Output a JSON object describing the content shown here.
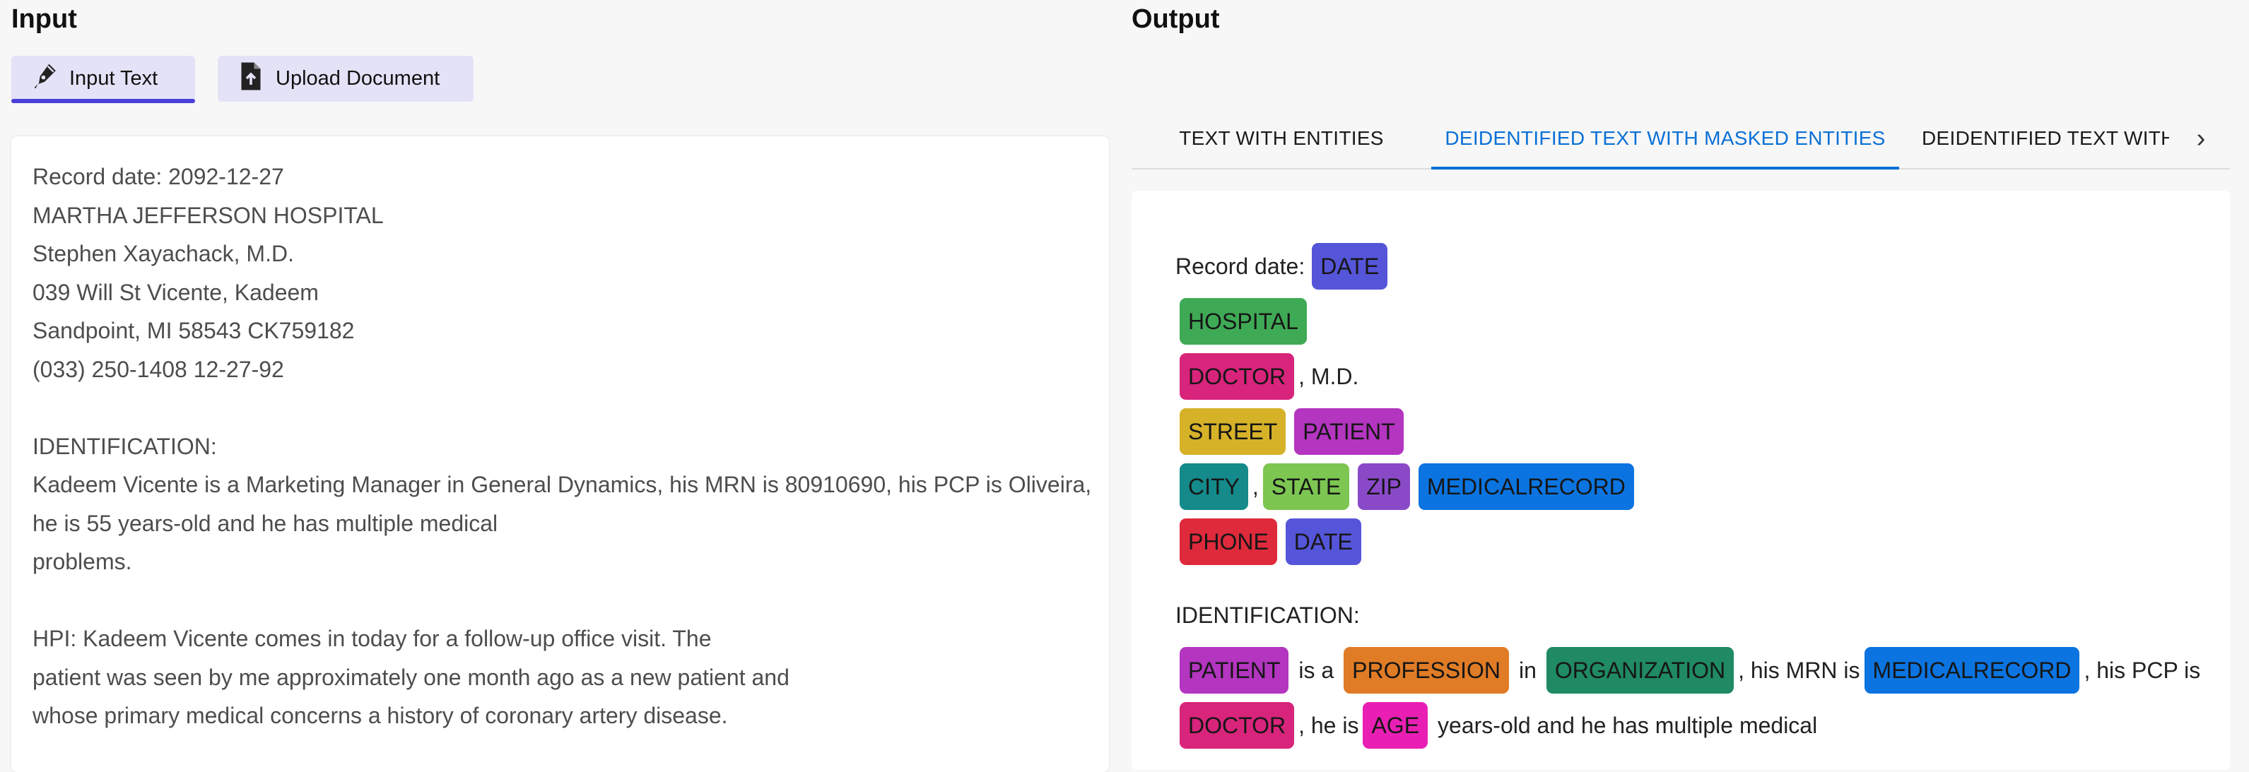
{
  "input_panel": {
    "title": "Input",
    "buttons": [
      {
        "label": "Input Text",
        "icon": "pen-icon",
        "active": true
      },
      {
        "label": "Upload Document",
        "icon": "file-upload-icon",
        "active": false
      }
    ],
    "text_lines": [
      "Record date: 2092-12-27",
      "MARTHA JEFFERSON HOSPITAL",
      "Stephen Xayachack, M.D.",
      "039 Will St Vicente, Kadeem",
      "Sandpoint, MI 58543 CK759182",
      "(033) 250-1408 12-27-92",
      "",
      "IDENTIFICATION:",
      "Kadeem Vicente is a Marketing Manager in General Dynamics, his MRN is 80910690, his PCP is Oliveira,",
      "he is 55 years-old and he has multiple medical",
      "problems.",
      "",
      "HPI: Kadeem Vicente comes in today for a follow-up office visit. The",
      "patient was seen by me approximately one month ago as a new patient and",
      "whose primary medical concerns a history of coronary artery disease."
    ]
  },
  "output_panel": {
    "title": "Output",
    "tabs": [
      {
        "label": "TEXT WITH ENTITIES",
        "active": false
      },
      {
        "label": "DEIDENTIFIED TEXT WITH MASKED ENTITIES",
        "active": true
      },
      {
        "label": "DEIDENTIFIED TEXT WITH",
        "active": false
      }
    ],
    "tab_scroll_icon": "chevron-right-icon",
    "chevron_glyph": "›",
    "rows": {
      "r1": {
        "t1": "Record date:",
        "c1": "DATE"
      },
      "r2": {
        "c1": "HOSPITAL"
      },
      "r3": {
        "c1": "DOCTOR",
        "t1": ", M.D."
      },
      "r4": {
        "c1": "STREET",
        "c2": "PATIENT"
      },
      "r5": {
        "c1": "CITY",
        "t1": ",",
        "c2": "STATE",
        "c3": "ZIP",
        "c4": "MEDICALRECORD"
      },
      "r6": {
        "c1": "PHONE",
        "c2": "DATE"
      },
      "r7": {
        "t1": "IDENTIFICATION:"
      },
      "r8": {
        "c1": "PATIENT",
        "t1": "is a",
        "c2": "PROFESSION",
        "t2": "in",
        "c3": "ORGANIZATION",
        "t3": ", his MRN is",
        "c4": "MEDICALRECORD",
        "t4": ", his PCP is"
      },
      "r9": {
        "c1": "DOCTOR",
        "t1": ", he is",
        "c2": "AGE",
        "t2": "years-old and he has multiple medical"
      }
    }
  },
  "entity_colors": {
    "DATE": "#5555d9",
    "HOSPITAL": "#3faa55",
    "DOCTOR": "#d8247b",
    "STREET": "#d6b229",
    "PATIENT": "#b335c0",
    "CITY": "#148a8a",
    "STATE": "#7cc651",
    "ZIP": "#8a4ac8",
    "MEDICALRECORD": "#0b74e0",
    "PHONE": "#df2a3c",
    "PROFESSION": "#e07c26",
    "ORGANIZATION": "#1f8a63",
    "AGE": "#e91fb4"
  },
  "accent_colors": {
    "active_tab": "#0a70d6",
    "active_mode_underline": "#4a3fd9",
    "mode_button_bg": "#e4e2f7"
  }
}
